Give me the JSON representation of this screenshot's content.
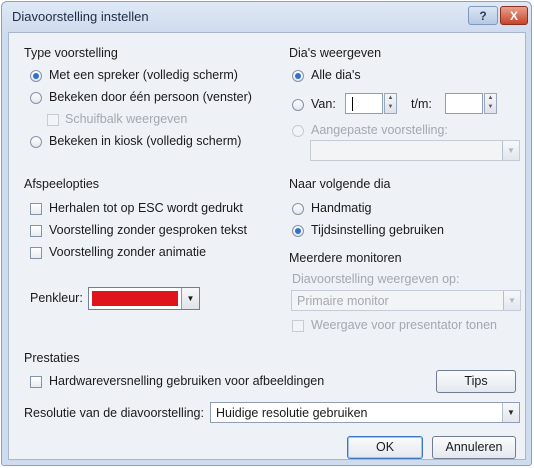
{
  "window": {
    "title": "Diavoorstelling instellen",
    "help_label": "?",
    "close_label": "X"
  },
  "type_voorstelling": {
    "heading": "Type voorstelling",
    "options": [
      {
        "label": "Met een spreker (volledig scherm)",
        "selected": true
      },
      {
        "label": "Bekeken door één persoon (venster)",
        "selected": false
      },
      {
        "label": "Bekeken in kiosk (volledig scherm)",
        "selected": false
      }
    ],
    "scrollbar_checkbox": "Schuifbalk weergeven"
  },
  "dias_weergeven": {
    "heading": "Dia's weergeven",
    "all_label": "Alle dia's",
    "from_label": "Van:",
    "from_value": "",
    "to_label": "t/m:",
    "to_value": "",
    "custom_label": "Aangepaste voorstelling:",
    "custom_value": ""
  },
  "afspeelopties": {
    "heading": "Afspeelopties",
    "options": [
      "Herhalen tot op ESC wordt gedrukt",
      "Voorstelling zonder gesproken tekst",
      "Voorstelling zonder animatie"
    ],
    "pen_label": "Penkleur:",
    "pen_color": "#e0151b"
  },
  "naar_volgende_dia": {
    "heading": "Naar volgende dia",
    "options": [
      {
        "label": "Handmatig",
        "selected": false
      },
      {
        "label": "Tijdsinstelling gebruiken",
        "selected": true
      }
    ]
  },
  "meerdere_monitoren": {
    "heading": "Meerdere monitoren",
    "show_on_label": "Diavoorstelling weergeven op:",
    "monitor_value": "Primaire monitor",
    "presenter_checkbox": "Weergave voor presentator tonen"
  },
  "prestaties": {
    "heading": "Prestaties",
    "hw_checkbox": "Hardwareversnelling gebruiken voor afbeeldingen",
    "tips_button": "Tips",
    "resolution_label": "Resolutie van de diavoorstelling:",
    "resolution_value": "Huidige resolutie gebruiken"
  },
  "footer": {
    "ok_button": "OK",
    "cancel_button": "Annuleren"
  },
  "icons": {
    "dropdown": "▼",
    "spin_up": "▲",
    "spin_down": "▼"
  }
}
